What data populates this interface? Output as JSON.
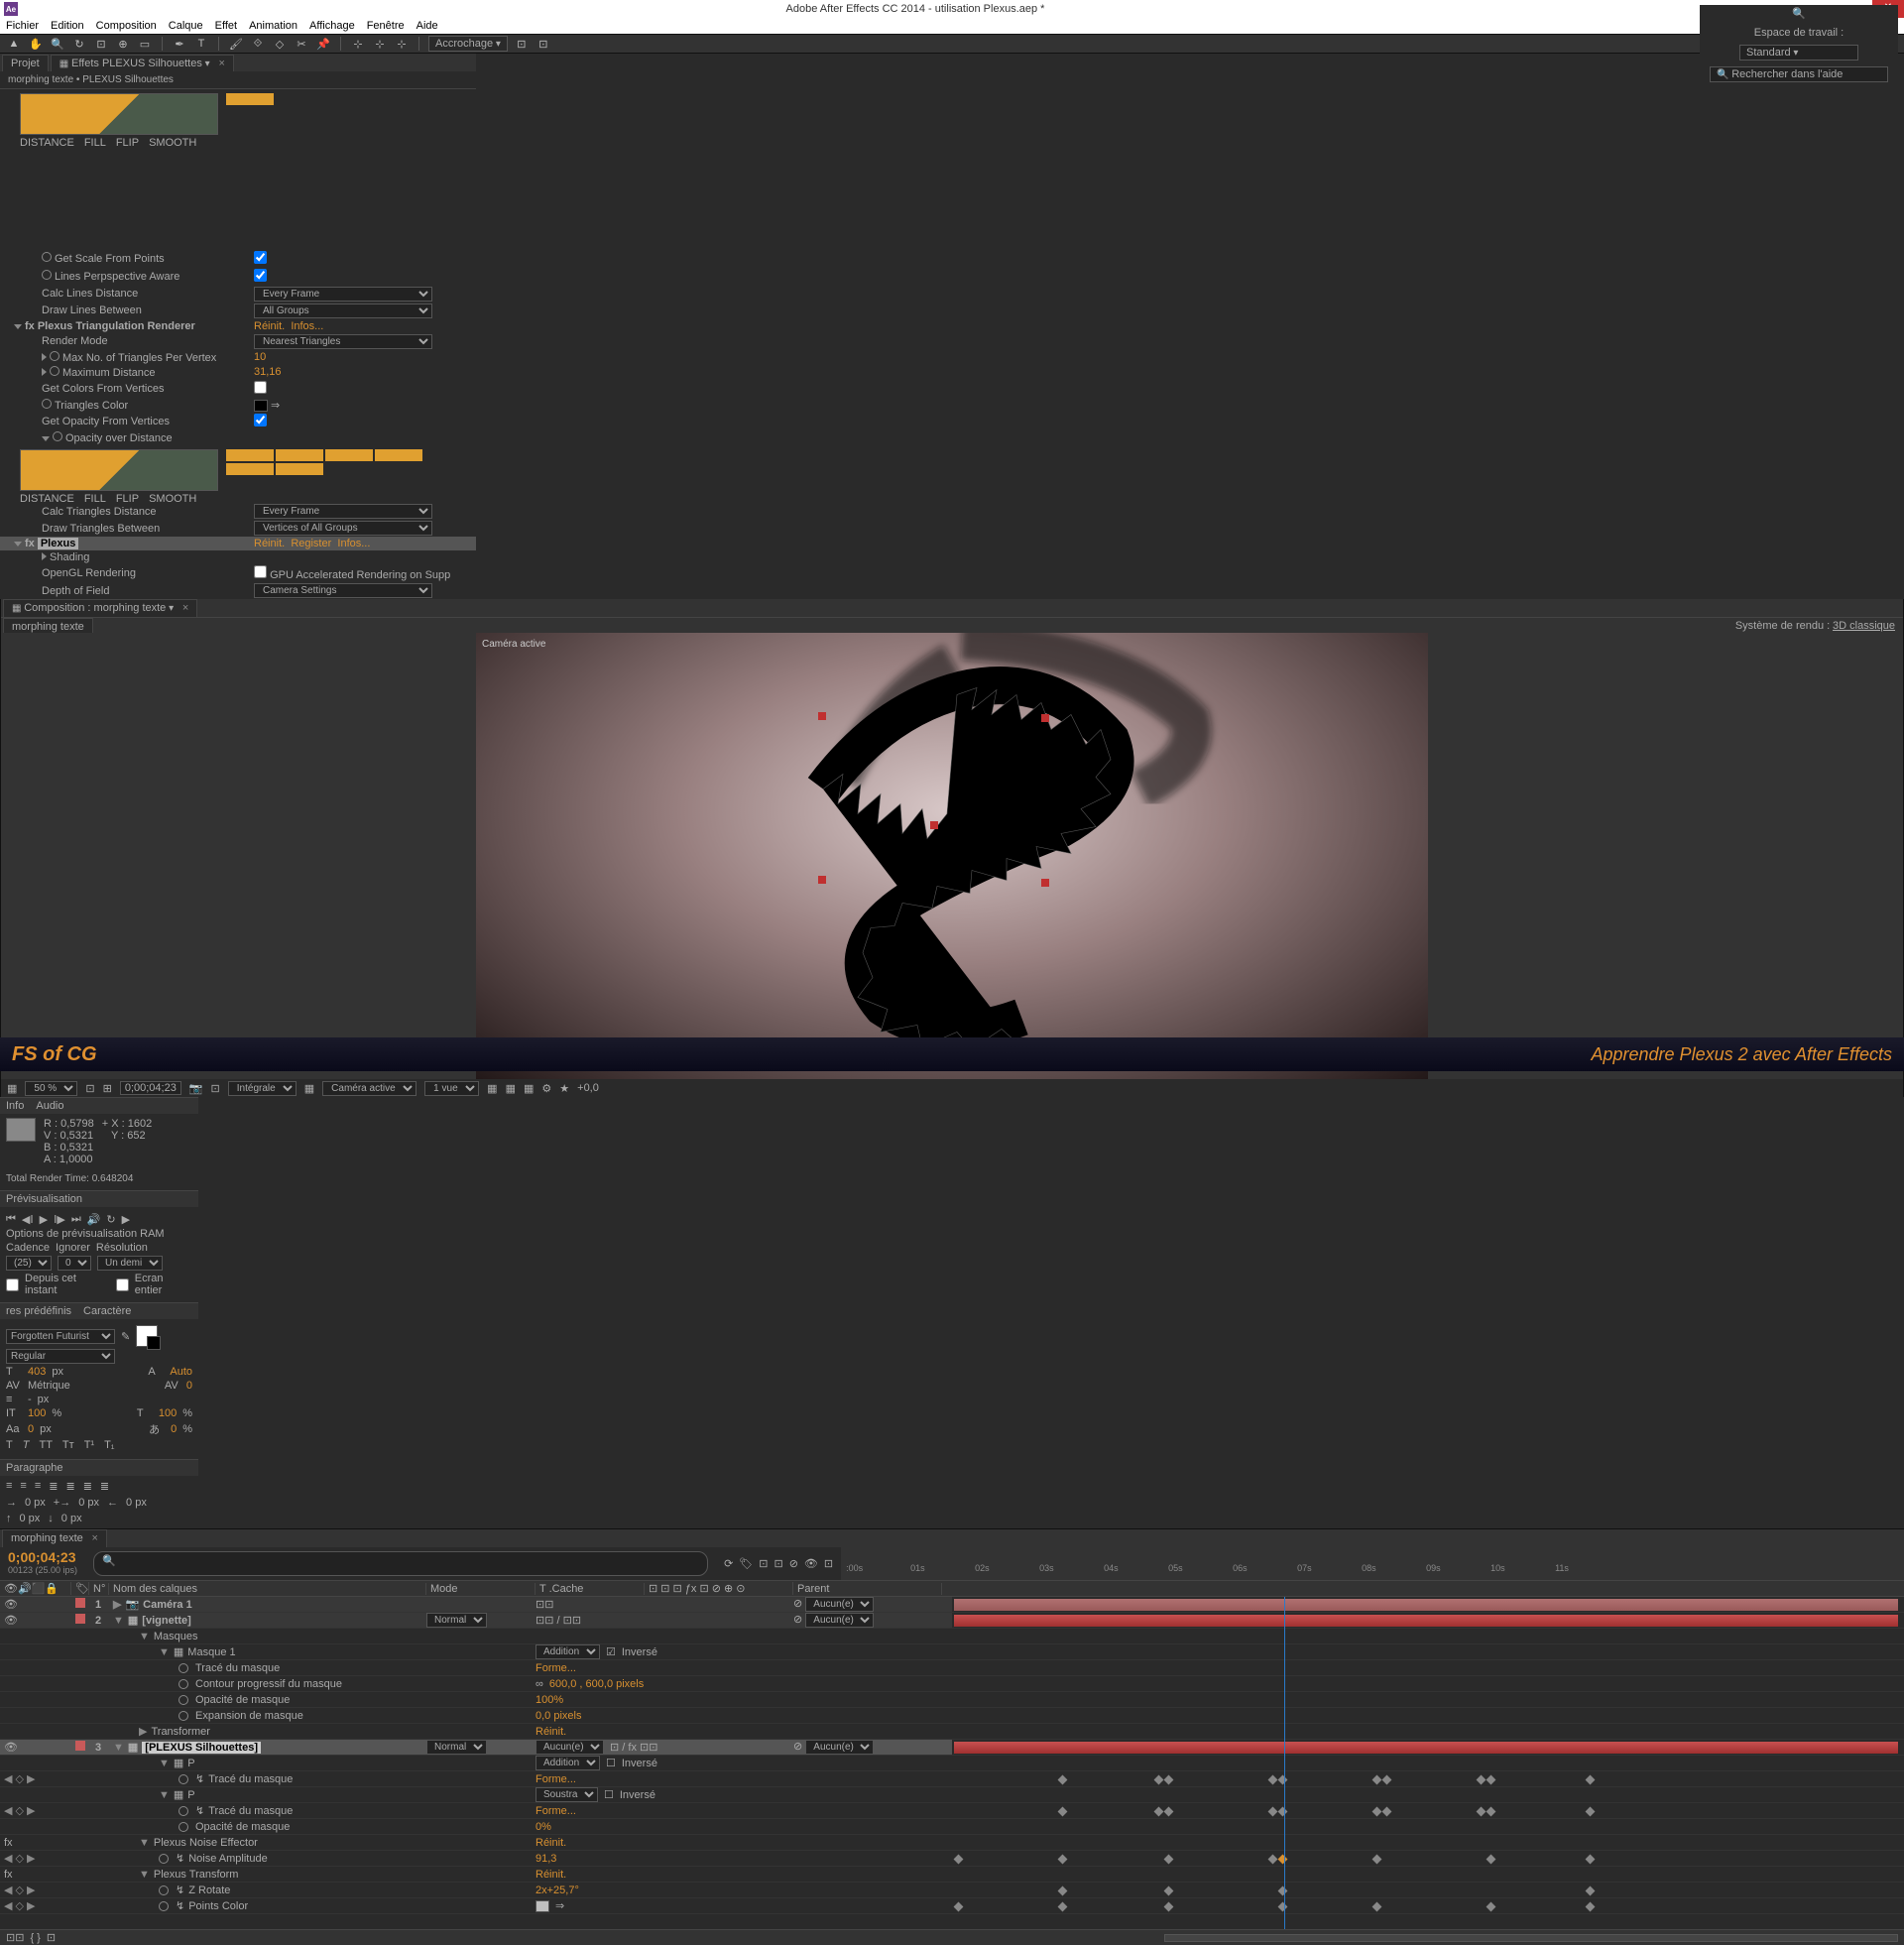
{
  "title": "Adobe After Effects CC 2014 - utilisation Plexus.aep *",
  "menu": [
    "Fichier",
    "Edition",
    "Composition",
    "Calque",
    "Effet",
    "Animation",
    "Affichage",
    "Fenêtre",
    "Aide"
  ],
  "snap": "Accrochage",
  "ws_label": "Espace de travail :",
  "ws_value": "Standard",
  "search_ph": "Rechercher dans l'aide",
  "project_tab": "Projet",
  "fx_tab": "Effets PLEXUS Silhouettes",
  "crumb": "morphing texte • PLEXUS Silhouettes",
  "fx": {
    "getScale": "Get Scale From Points",
    "linesPersp": "Lines Perpspective Aware",
    "calcLines": "Calc Lines Distance",
    "calcLines_v": "Every Frame",
    "drawLines": "Draw Lines Between",
    "drawLines_v": "All Groups",
    "triRenderer": "Plexus Triangulation Renderer",
    "reinit": "Réinit.",
    "infos": "Infos...",
    "register": "Register",
    "renderMode": "Render Mode",
    "renderMode_v": "Nearest Triangles",
    "maxTri": "Max No. of Triangles Per Vertex",
    "maxTri_v": "10",
    "maxDist": "Maximum Distance",
    "maxDist_v": "31,16",
    "getColors": "Get Colors From Vertices",
    "triColor": "Triangles Color",
    "getOpacity": "Get Opacity From Vertices",
    "opDist": "Opacity over Distance",
    "gDist": "DISTANCE",
    "gFill": "FILL",
    "gFlip": "FLIP",
    "gSmooth": "SMOOTH",
    "calcTri": "Calc Triangles Distance",
    "calcTri_v": "Every Frame",
    "drawTri": "Draw Triangles Between",
    "drawTri_v": "Vertices of All Groups",
    "plexus": "Plexus",
    "shading": "Shading",
    "openGL": "OpenGL Rendering",
    "gpu": "GPU Accelerated Rendering on Supp",
    "dof": "Depth of Field",
    "dof_v": "Camera Settings"
  },
  "comp": {
    "tab": "Composition : morphing texte",
    "subtab": "morphing texte",
    "render": "Système de rendu :",
    "render_v": "3D classique",
    "viewlabel": "Caméra active",
    "zoom": "50 %",
    "tc": "0;00;04;23",
    "quality": "Intégrale",
    "view": "Caméra active",
    "vue": "1 vue",
    "exp": "+0,0"
  },
  "info": {
    "tab1": "Info",
    "tab2": "Audio",
    "r": "R : 0,5798",
    "v": "V : 0,5321",
    "b": "B : 0,5321",
    "a": "A : 1,0000",
    "x": "X : 1602",
    "y": "Y : 652",
    "render": "Total Render Time: 0.648204"
  },
  "prev": {
    "tab": "Prévisualisation",
    "ram": "Options de prévisualisation RAM",
    "cadence": "Cadence",
    "ignorer": "Ignorer",
    "reso": "Résolution",
    "cad_v": "(25)",
    "ign_v": "0",
    "res_v": "Un demi",
    "depuis": "Depuis cet instant",
    "ecran": "Ecran entier"
  },
  "chr": {
    "tab1": "res prédéfinis",
    "tab2": "Caractère",
    "font": "Forgotten Futurist",
    "style": "Regular",
    "size": "403",
    "px": "px",
    "auto": "Auto",
    "metric": "Métrique",
    "zero": "0",
    "dash": "-",
    "pct100": "100",
    "pct": "%",
    "px0": "0"
  },
  "par": {
    "tab": "Paragraphe",
    "px0": "0 px"
  },
  "tl": {
    "tab": "morphing texte",
    "time": "0;00;04;23",
    "sub": "00123 (25.00 ips)",
    "col_num": "N°",
    "col_name": "Nom des calques",
    "col_mode": "Mode",
    "col_cache": "T  .Cache",
    "col_parent": "Parent",
    "layer1": "Caméra 1",
    "layer2": "[vignette]",
    "layer3": "[PLEXUS Silhouettes]",
    "normal": "Normal",
    "aucun": "Aucun(e)",
    "masques": "Masques",
    "masque1": "Masque 1",
    "addition": "Addition",
    "soustra": "Soustra",
    "inverse": "Inversé",
    "trace": "Tracé du masque",
    "forme": "Forme...",
    "contour": "Contour progressif du masque",
    "contour_v": "600,0 , 600,0 pixels",
    "opmask": "Opacité de masque",
    "opmask_v": "100%",
    "opmask_v0": "0%",
    "exp": "Expansion de masque",
    "exp_v": "0,0 pixels",
    "trans": "Transformer",
    "reinit": "Réinit.",
    "p": "P",
    "noise": "Plexus Noise Effector",
    "namp": "Noise Amplitude",
    "namp_v": "91,3",
    "ptrans": "Plexus Transform",
    "zrot": "Z Rotate",
    "zrot_v": "2x+25,7°",
    "pcolor": "Points Color",
    "ticks": [
      ":00s",
      "01s",
      "02s",
      "03s",
      "04s",
      "05s",
      "06s",
      "07s",
      "08s",
      "09s",
      "10s",
      "11s"
    ]
  },
  "footer": {
    "logo": "FS of CG",
    "text": "Apprendre Plexus 2 avec After Effects"
  }
}
